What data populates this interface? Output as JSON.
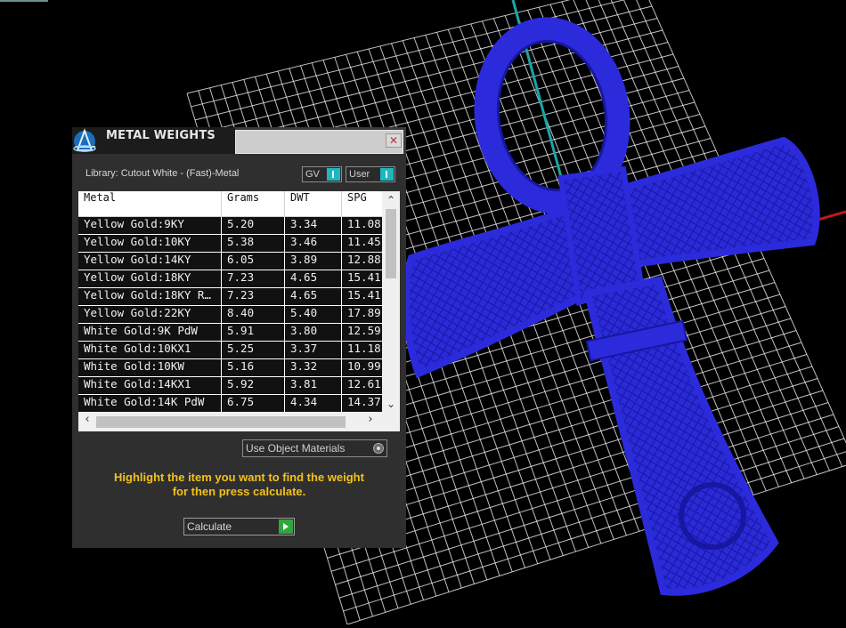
{
  "panel": {
    "title": "METAL WEIGHTS",
    "close_icon": "close-icon",
    "library_label": "Library: Cutout White - (Fast)-Metal",
    "toggles": {
      "gv": "GV",
      "user": "User"
    }
  },
  "table": {
    "headers": [
      "Metal",
      "Grams",
      "DWT",
      "SPG"
    ],
    "rows": [
      [
        "Yellow Gold:9KY",
        "5.20",
        "3.34",
        "11.08"
      ],
      [
        "Yellow Gold:10KY",
        "5.38",
        "3.46",
        "11.45"
      ],
      [
        "Yellow Gold:14KY",
        "6.05",
        "3.89",
        "12.88"
      ],
      [
        "Yellow Gold:18KY",
        "7.23",
        "4.65",
        "15.41"
      ],
      [
        "Yellow Gold:18KY R…",
        "7.23",
        "4.65",
        "15.41"
      ],
      [
        "Yellow Gold:22KY",
        "8.40",
        "5.40",
        "17.89"
      ],
      [
        "White Gold:9K PdW",
        "5.91",
        "3.80",
        "12.59"
      ],
      [
        "White Gold:10KX1",
        "5.25",
        "3.37",
        "11.18"
      ],
      [
        "White Gold:10KW",
        "5.16",
        "3.32",
        "10.99"
      ],
      [
        "White Gold:14KX1",
        "5.92",
        "3.81",
        "12.61"
      ],
      [
        "White Gold:14K PdW",
        "6.75",
        "4.34",
        "14.37"
      ]
    ]
  },
  "object_materials_label": "Use Object Materials",
  "hint_line1": "Highlight the item you want to find the weight",
  "hint_line2": "for then press calculate.",
  "calculate_label": "Calculate",
  "colors": {
    "model": "#2b2bdc",
    "grid": "#ffffff",
    "axis_cyan": "#1aa6a6",
    "axis_red": "#c01818",
    "hint_text": "#f2c21c"
  }
}
